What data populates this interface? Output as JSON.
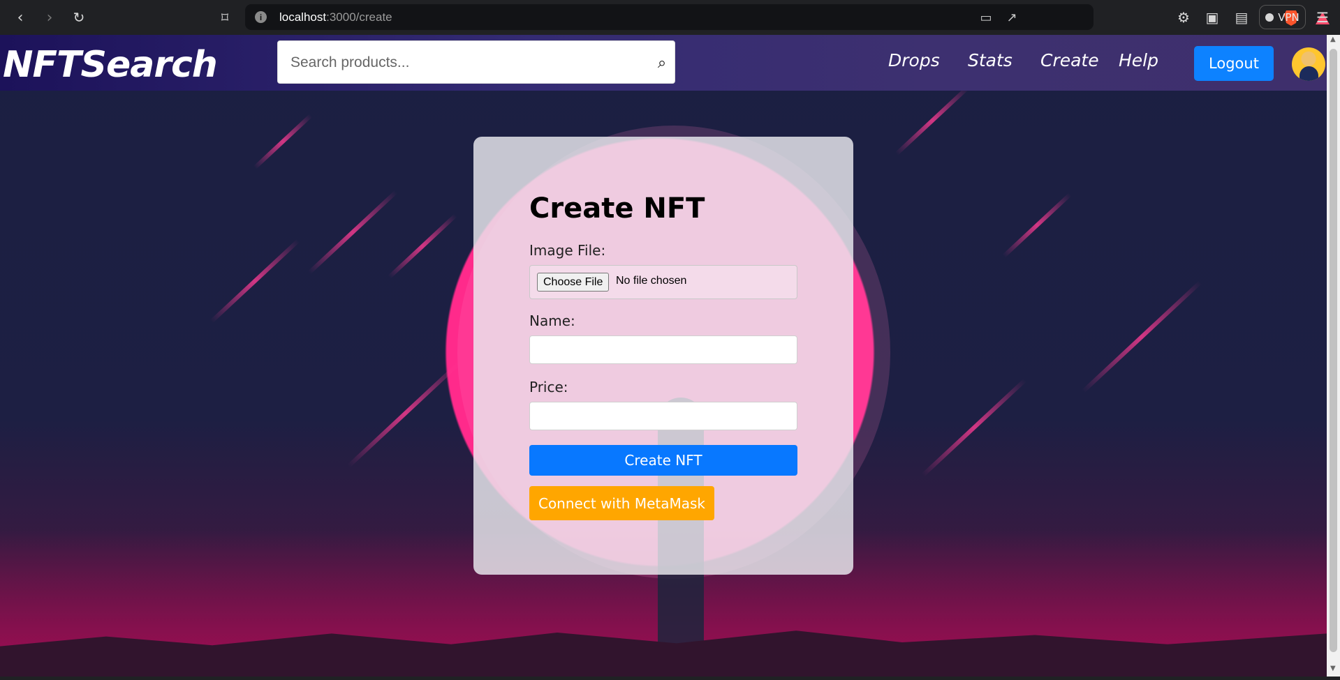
{
  "browser": {
    "address_host": "localhost",
    "address_path": ":3000/create",
    "vpn_label": "VPN",
    "icons": [
      "back-icon",
      "forward-icon",
      "reload-icon",
      "bookmark-icon",
      "site-info-icon",
      "cast-icon",
      "share-icon",
      "brave-shield-icon",
      "brave-rewards-icon",
      "extensions-icon",
      "sidebar-icon",
      "wallet-icon",
      "menu-icon"
    ]
  },
  "app": {
    "brand": "NFTSearch",
    "search_placeholder": "Search products...",
    "nav": [
      "Drops",
      "Stats",
      "Create",
      "Help"
    ],
    "logout": "Logout"
  },
  "form": {
    "title": "Create NFT",
    "image_label": "Image File:",
    "choose_file": "Choose File",
    "no_file": "No file chosen",
    "name_label": "Name:",
    "price_label": "Price:",
    "submit": "Create NFT",
    "connect": "Connect with MetaMask"
  },
  "colors": {
    "primary": "#0d82ff",
    "metamask": "#ffa600",
    "moon": "#ff2a8b"
  }
}
